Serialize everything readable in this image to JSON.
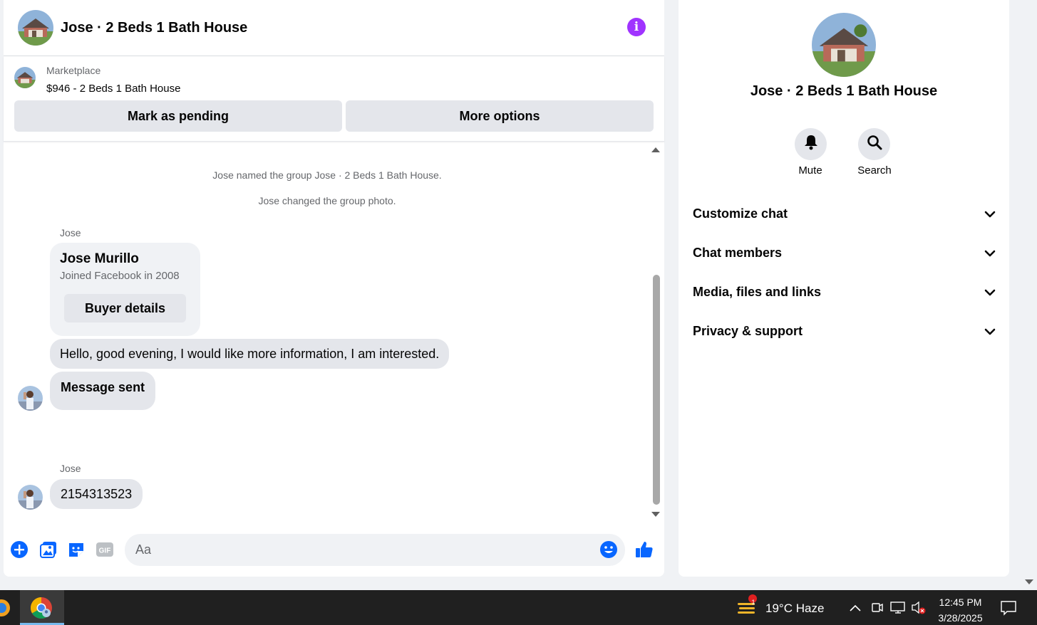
{
  "chat": {
    "title": "Jose · 2 Beds 1 Bath House",
    "listing": {
      "label": "Marketplace",
      "price_title": "$946 - 2 Beds 1 Bath House"
    },
    "actions": {
      "pending": "Mark as pending",
      "more": "More options"
    },
    "system_messages": [
      "Jose named the group Jose · 2 Beds 1 Bath House.",
      "Jose changed the group photo."
    ],
    "buyer_card": {
      "sender": "Jose",
      "name": "Jose Murillo",
      "joined": "Joined Facebook in 2008",
      "button": "Buyer details"
    },
    "messages": [
      "Hello, good evening, I would like more information, I am interested.",
      "Message sent",
      "2154313523"
    ],
    "second_sender": "Jose",
    "composer": {
      "placeholder": "Aa",
      "icons": [
        "plus-icon",
        "image-icon",
        "sticker-icon",
        "gif-icon",
        "emoji-icon",
        "like-icon"
      ]
    }
  },
  "info_panel": {
    "title": "Jose · 2 Beds 1 Bath House",
    "mute_label": "Mute",
    "search_label": "Search",
    "sections": [
      "Customize chat",
      "Chat members",
      "Media, files and links",
      "Privacy & support"
    ]
  },
  "taskbar": {
    "notification_count": "1",
    "weather": "19°C  Haze",
    "time": "12:45 PM",
    "date": "3/28/2025"
  },
  "colors": {
    "accent": "#0866ff",
    "info_purple": "#a033ff",
    "bubble": "#e4e6eb"
  }
}
